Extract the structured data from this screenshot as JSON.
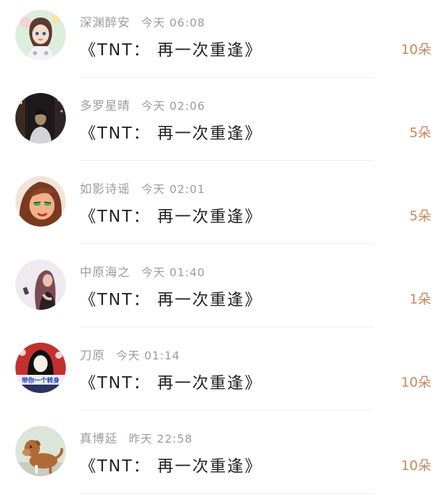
{
  "items": [
    {
      "user": "深渊醉安",
      "time": "今天 06:08",
      "title": "《TNT： 再一次重逢》",
      "count": "10朵",
      "avatar_icon": "anime-girl-avatar",
      "colors": [
        "#d9ecd6",
        "#f3d7c2",
        "#5b3b2f"
      ]
    },
    {
      "user": "多罗星晴",
      "time": "今天 02:06",
      "title": "《TNT： 再一次重逢》",
      "count": "5朵",
      "avatar_icon": "man-street-night-avatar",
      "colors": [
        "#1e1a1c",
        "#a88c6a",
        "#d4d4d8"
      ]
    },
    {
      "user": "如影诗谣",
      "time": "今天 02:01",
      "title": "《TNT： 再一次重逢》",
      "count": "5朵",
      "avatar_icon": "cartoon-woman-avatar",
      "colors": [
        "#7a3a22",
        "#f1b28a",
        "#3fb14a"
      ]
    },
    {
      "user": "中原海之",
      "time": "今天 01:40",
      "title": "《TNT： 再一次重逢》",
      "count": "1朵",
      "avatar_icon": "woman-portrait-avatar",
      "colors": [
        "#efeaf0",
        "#7a4b52",
        "#2a2024"
      ]
    },
    {
      "user": "刀原",
      "time": "今天 01:14",
      "title": "《TNT： 再一次重逢》",
      "count": "10朵",
      "avatar_icon": "dark-hair-girl-avatar",
      "colors": [
        "#c2302f",
        "#101010",
        "#f7eee8"
      ]
    },
    {
      "user": "真博延",
      "time": "昨天 22:58",
      "title": "《TNT： 再一次重逢》",
      "count": "10朵",
      "avatar_icon": "dog-avatar",
      "colors": [
        "#dde4d8",
        "#b06a35",
        "#f4f0ea"
      ]
    }
  ],
  "avatar_text": "带你一个转身"
}
